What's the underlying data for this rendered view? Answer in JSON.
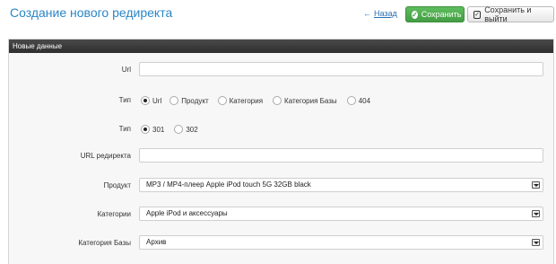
{
  "header": {
    "title": "Создание нового редиректа",
    "back_label": "Назад",
    "back_arrow": "←",
    "save_label": "Сохранить",
    "save_exit_label": "Сохранить и выйти"
  },
  "panel": {
    "title": "Новые данные"
  },
  "form": {
    "url": {
      "label": "Url",
      "value": ""
    },
    "type": {
      "label": "Тип",
      "options": [
        "Url",
        "Продукт",
        "Категория",
        "Категория Базы",
        "404"
      ],
      "selected": "Url"
    },
    "code": {
      "label": "Тип",
      "options": [
        "301",
        "302"
      ],
      "selected": "301"
    },
    "redirect_url": {
      "label": "URL редиректа",
      "value": ""
    },
    "product": {
      "label": "Продукт",
      "value": "MP3 / MP4-плеер Apple iPod touch 5G 32GB black"
    },
    "category": {
      "label": "Категории",
      "value": "Apple iPod и аксессуары"
    },
    "base_category": {
      "label": "Категория Базы",
      "value": "Архив"
    }
  },
  "colors": {
    "title": "#2a86c6",
    "save_button": "#449d44",
    "panel_head": "#333333"
  }
}
